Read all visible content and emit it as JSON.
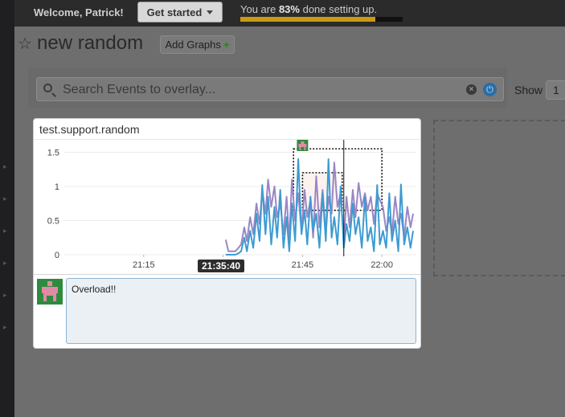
{
  "topbar": {
    "welcome": "Welcome, Patrick!",
    "get_started_label": "Get started",
    "progress_prefix": "You are ",
    "progress_percent_text": "83%",
    "progress_suffix": " done setting up.",
    "progress_fraction": 0.83
  },
  "dashboard": {
    "title": "new random",
    "add_graphs_label": "Add Graphs",
    "add_graphs_plus": "+"
  },
  "search": {
    "placeholder": "Search Events to overlay...",
    "show_label": "Show",
    "show_value": "1"
  },
  "graph": {
    "title": "test.support.random",
    "hover_time": "21:35:40",
    "event_text": "Overload!!",
    "colors": {
      "series_a": "#9b86c4",
      "series_b": "#3d9bd1",
      "grid": "#ececec",
      "event_marker": "#2e8b3e",
      "event_figure": "#e08aa6"
    }
  },
  "chart_data": {
    "type": "line",
    "title": "test.support.random",
    "xlabel": "",
    "ylabel": "",
    "x_ticks": [
      "21:15",
      "21:30",
      "21:45",
      "22:00"
    ],
    "y_ticks": [
      "0",
      "0.5",
      "1",
      "1.5"
    ],
    "ylim": [
      0,
      1.6
    ],
    "x_range_minutes": [
      0,
      60
    ],
    "series": [
      {
        "x": [
          30.5,
          31.0,
          31.6,
          32.3,
          32.9,
          33.4,
          34.0,
          34.5,
          35.1,
          35.7,
          36.3,
          36.9,
          37.4,
          38.0,
          38.5,
          39.1,
          39.7,
          40.2,
          40.8,
          41.4,
          42.0,
          42.5,
          43.0,
          43.6,
          44.2,
          44.8,
          45.4,
          45.9,
          46.5,
          47.0,
          47.6,
          48.2,
          48.8,
          49.4,
          49.9,
          50.5,
          51.0,
          51.6,
          52.2,
          52.8,
          53.3,
          53.9,
          54.5,
          55.0,
          55.6,
          56.2,
          56.8,
          57.3,
          57.9,
          58.5,
          59.1,
          59.6,
          60.2,
          60.8,
          61.4,
          61.9,
          62.5,
          63.1,
          63.6,
          64.2,
          64.8,
          65.4,
          65.9
        ],
        "values": [
          0.22,
          0.05,
          0.05,
          0.05,
          0.1,
          0.15,
          0.4,
          0.2,
          0.55,
          0.3,
          0.75,
          0.45,
          0.95,
          0.6,
          1.1,
          0.7,
          1.0,
          0.55,
          0.75,
          0.3,
          0.85,
          0.2,
          1.1,
          0.5,
          0.9,
          0.35,
          0.95,
          0.55,
          0.8,
          0.25,
          1.15,
          0.4,
          0.95,
          0.3,
          0.85,
          0.6,
          1.35,
          0.7,
          0.9,
          0.2,
          0.85,
          0.4,
          0.95,
          0.55,
          1.05,
          0.7,
          0.9,
          0.65,
          0.85,
          0.45,
          0.9,
          0.8,
          0.7,
          0.35,
          0.55,
          0.3,
          0.85,
          0.45,
          0.6,
          0.25,
          0.7,
          0.4,
          0.6
        ]
      },
      {
        "x": [
          30.5,
          31.0,
          31.6,
          32.3,
          32.9,
          33.4,
          34.0,
          34.5,
          35.1,
          35.7,
          36.3,
          36.9,
          37.4,
          38.0,
          38.5,
          39.1,
          39.7,
          40.2,
          40.8,
          41.4,
          42.0,
          42.5,
          43.0,
          43.6,
          44.2,
          44.8,
          45.4,
          45.9,
          46.5,
          47.0,
          47.6,
          48.2,
          48.8,
          49.4,
          49.9,
          50.5,
          51.0,
          51.6,
          52.2,
          52.8,
          53.3,
          53.9,
          54.5,
          55.0,
          55.6,
          56.2,
          56.8,
          57.3,
          57.9,
          58.5,
          59.1,
          59.6,
          60.2,
          60.8,
          61.4,
          61.9,
          62.5,
          63.1,
          63.6,
          64.2,
          64.8,
          65.4,
          65.9
        ],
        "values": [
          0.0,
          0.0,
          0.0,
          0.0,
          0.02,
          0.05,
          0.25,
          0.05,
          0.35,
          0.1,
          0.6,
          0.2,
          1.02,
          0.3,
          0.85,
          0.15,
          0.7,
          0.25,
          0.95,
          0.1,
          0.55,
          0.05,
          0.75,
          0.2,
          1.4,
          0.3,
          0.65,
          0.15,
          0.85,
          0.35,
          0.6,
          0.1,
          0.9,
          0.2,
          1.4,
          0.25,
          0.55,
          0.15,
          1.0,
          0.1,
          0.45,
          0.2,
          0.75,
          0.3,
          0.55,
          0.1,
          0.85,
          0.2,
          0.4,
          0.05,
          1.02,
          0.15,
          0.35,
          0.1,
          0.9,
          0.2,
          0.5,
          0.05,
          1.03,
          0.15,
          0.4,
          0.1,
          0.35
        ]
      }
    ],
    "crosshair_x": 52.8,
    "event_x": 45.0,
    "grid": true
  }
}
